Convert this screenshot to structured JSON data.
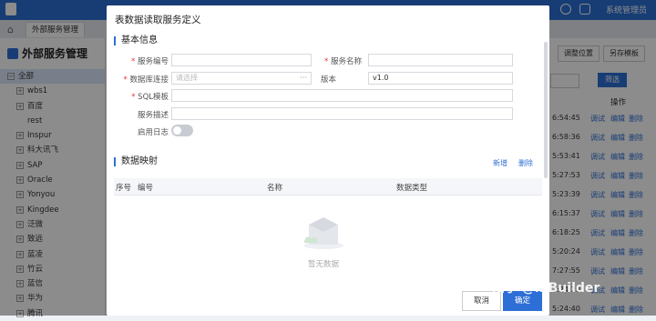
{
  "colors": {
    "accent": "#2d6fd6",
    "topbar": "#2d6fd6",
    "required": "#e33"
  },
  "topbar": {
    "user": "系统管理员"
  },
  "tabs": {
    "home_icon": "home-icon",
    "active_tab": "外部服务管理"
  },
  "sidebar": {
    "title": "外部服务管理",
    "items": [
      {
        "label": "全部",
        "toggle": "−"
      },
      {
        "label": "wbs1",
        "toggle": "+"
      },
      {
        "label": "百度",
        "toggle": "+"
      },
      {
        "label": "rest",
        "toggle": ""
      },
      {
        "label": "Inspur",
        "toggle": "+"
      },
      {
        "label": "科大讯飞",
        "toggle": "+"
      },
      {
        "label": "SAP",
        "toggle": "+"
      },
      {
        "label": "Oracle",
        "toggle": "+"
      },
      {
        "label": "Yonyou",
        "toggle": "+"
      },
      {
        "label": "Kingdee",
        "toggle": "+"
      },
      {
        "label": "泛微",
        "toggle": "+"
      },
      {
        "label": "致远",
        "toggle": "+"
      },
      {
        "label": "蓝凌",
        "toggle": "+"
      },
      {
        "label": "竹云",
        "toggle": "+"
      },
      {
        "label": "蓝信",
        "toggle": "+"
      },
      {
        "label": "华为",
        "toggle": "+"
      },
      {
        "label": "腾讯",
        "toggle": "+"
      }
    ]
  },
  "right_pane": {
    "adjust_btn": "调整位置",
    "save_tpl_btn": "另存模板",
    "filter_btn": "筛选",
    "col_action": "操作",
    "rows": [
      {
        "time": "6:54:45"
      },
      {
        "time": "6:58:36"
      },
      {
        "time": "5:53:41"
      },
      {
        "time": "5:27:53"
      },
      {
        "time": "5:23:39"
      },
      {
        "time": "6:15:37"
      },
      {
        "time": "6:18:25"
      },
      {
        "time": "5:20:24"
      },
      {
        "time": "7:27:55"
      },
      {
        "time": "7:24:29"
      },
      {
        "time": "5:24:40"
      }
    ],
    "row_actions": {
      "test": "调试",
      "edit": "编辑",
      "delete": "删除"
    }
  },
  "dialog": {
    "title": "表数据读取服务定义",
    "basic_section": "基本信息",
    "fields": {
      "service_code_label": "服务编号",
      "service_name_label": "服务名称",
      "db_conn_label": "数据库连接",
      "db_conn_placeholder": "请选择",
      "version_label": "版本",
      "version_value": "v1.0",
      "sql_label": "SQL模板",
      "desc_label": "服务描述",
      "log_label": "启用日志"
    },
    "mapping_section": "数据映射",
    "add_link": "新增",
    "delete_link": "删除",
    "table_headers": [
      "序号",
      "编号",
      "名称",
      "数据类型"
    ],
    "empty_text": "暂无数据",
    "cancel_btn": "取消",
    "ok_btn": "确定"
  },
  "watermark": "知乎 @inBuilder"
}
